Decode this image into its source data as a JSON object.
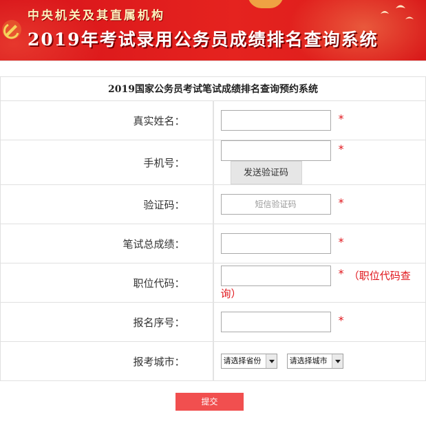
{
  "banner": {
    "subtitle": "中央机关及其直属机构",
    "title": "2019年考试录用公务员成绩排名查询系统"
  },
  "form": {
    "heading": "2019国家公务员考试笔试成绩排名查询预约系统",
    "required_mark": "*",
    "fields": {
      "name": {
        "label": "真实姓名：",
        "value": ""
      },
      "phone": {
        "label": "手机号：",
        "value": "",
        "send_code_label": "发送验证码"
      },
      "code": {
        "label": "验证码：",
        "placeholder": "短信验证码"
      },
      "score": {
        "label": "笔试总成绩：",
        "value": ""
      },
      "position": {
        "label": "职位代码：",
        "value": "",
        "lookup_link": "（职位代码查询）"
      },
      "reg_no": {
        "label": "报名序号：",
        "value": ""
      },
      "city": {
        "label": "报考城市：",
        "province_select": "请选择省份",
        "city_select": "请选择城市"
      }
    },
    "submit_label": "提交"
  },
  "colors": {
    "banner_red": "#e5231f",
    "required_red": "#e0141a",
    "submit_button": "#f14f4f"
  }
}
